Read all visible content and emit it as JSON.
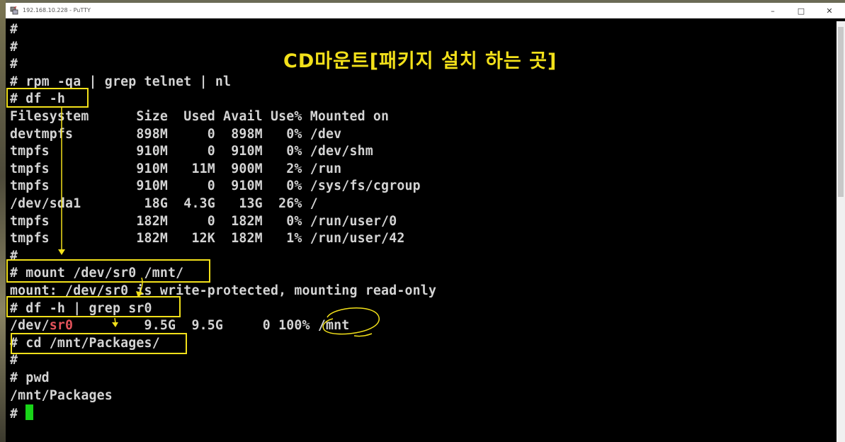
{
  "window": {
    "title": "192.168.10.228 - PuTTY",
    "minimize": "–",
    "maximize": "□",
    "close": "✕"
  },
  "annotation": {
    "title": "CD마운트[패키지 설치 하는 곳]",
    "color": "#f2e01a"
  },
  "terminal": {
    "cursor_color": "#18d418",
    "lines": [
      "#",
      "#",
      "#",
      "# rpm -qa | grep telnet | nl",
      "# df -h",
      "Filesystem      Size  Used Avail Use% Mounted on",
      "devtmpfs        898M     0  898M   0% /dev",
      "tmpfs           910M     0  910M   0% /dev/shm",
      "tmpfs           910M   11M  900M   2% /run",
      "tmpfs           910M     0  910M   0% /sys/fs/cgroup",
      "/dev/sda1        18G  4.3G   13G  26% /",
      "tmpfs           182M     0  182M   0% /run/user/0",
      "tmpfs           182M   12K  182M   1% /run/user/42",
      "#",
      "# mount /dev/sr0 /mnt/",
      "mount: /dev/sr0 is write-protected, mounting read-only",
      "# df -h | grep sr0",
      {
        "before": "/dev/",
        "highlight": "sr0",
        "after": "         9.5G  9.5G     0 100% /mnt"
      },
      "# cd /mnt/Packages/",
      "#",
      "# pwd",
      "/mnt/Packages",
      "# "
    ]
  }
}
